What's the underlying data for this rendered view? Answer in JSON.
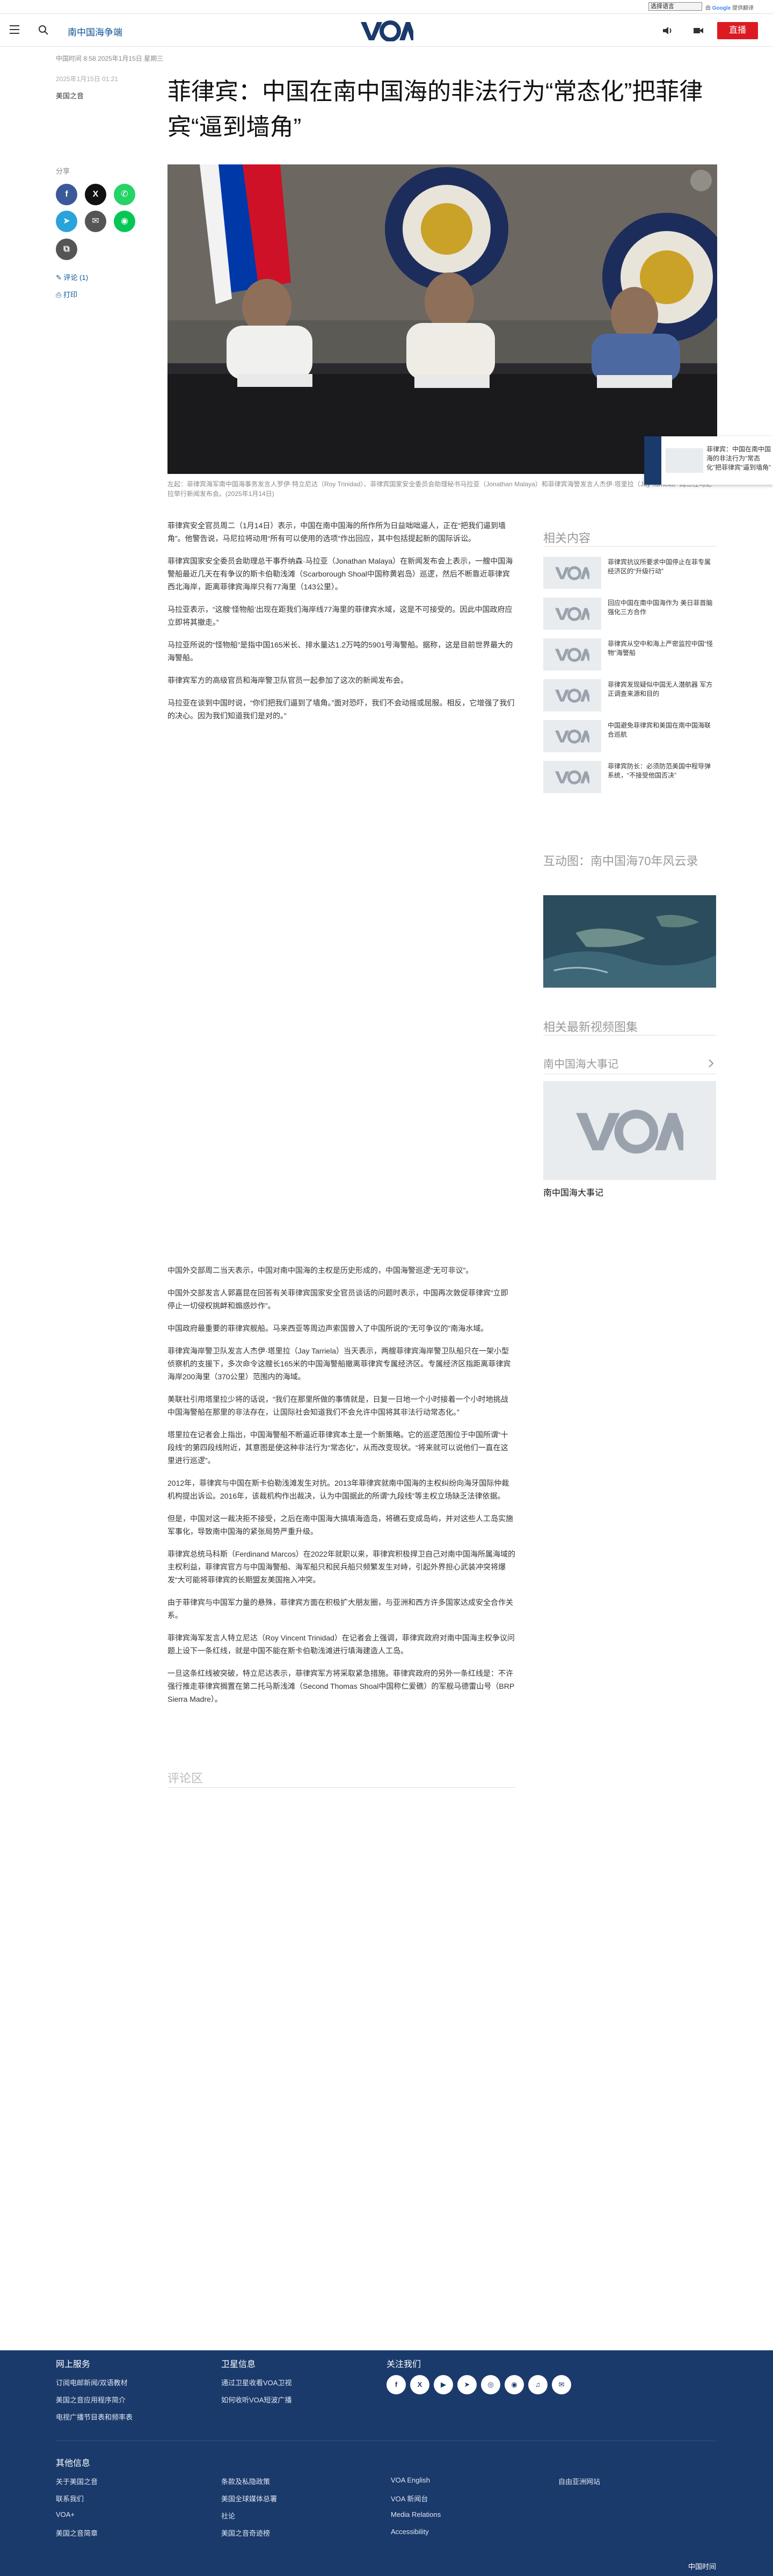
{
  "translate": {
    "select_value": "选择语言",
    "powered_prefix": "由",
    "powered_brand": "Google",
    "powered_suffix": "提供翻译"
  },
  "header": {
    "section": "南中国海争端",
    "live": "直播"
  },
  "article": {
    "meta_line": "中国时间 8:58 2025年1月15日 星期三",
    "date_line": "2025年1月15日 01:21",
    "category": "美国之音",
    "title": "菲律宾：中国在南中国海的非法行为“常态化”把菲律宾“逼到墙角”",
    "caption": "左起：菲律宾海军南中国海事务发言人罗伊·特立尼达（Roy Trinidad）、菲律宾国家安全委员会助理秘书马拉亚（Jonathan Malaya）和菲律宾海警发言人杰伊·塔里拉（Jay Tarriela）周二在马尼拉举行新闻发布会。(2025年1月14日)",
    "paragraphs_top": [
      "菲律宾安全官员周二（1月14日）表示，中国在南中国海的所作所为日益咄咄逼人，正在“把我们逼到墙角”。他警告说，马尼拉将动用“所有可以使用的选项”作出回应，其中包括提起新的国际诉讼。",
      "菲律宾国家安全委员会助理总干事乔纳森·马拉亚（Jonathan Malaya）在新闻发布会上表示，一艘中国海警船最近几天在有争议的斯卡伯勒浅滩（Scarborough Shoal中国称黄岩岛）巡逻，然后不断靠近菲律宾西北海岸，距离菲律宾海岸只有77海里（143公里）。",
      "马拉亚表示，“这艘‘怪物船’出现在距我们海岸线77海里的菲律宾水域，这是不可接受的。因此中国政府应立即将其撤走。”",
      "马拉亚所说的“怪物船”是指中国165米长、排水量达1.2万吨的5901号海警船。据称，这是目前世界最大的海警船。",
      "菲律宾军方的高级官员和海岸警卫队官员一起参加了这次的新闻发布会。",
      "马拉亚在谈到中国时说，“你们把我们逼到了墙角。”面对恐吓，我们不会动摇或屈服。相反，它增强了我们的决心。因为我们知道我们是对的。”"
    ],
    "paragraphs_bottom": [
      "中国外交部周二当天表示，中国对南中国海的主权是历史形成的，中国海警巡逻“无可非议”。",
      "中国外交部发言人郭嘉昆在回答有关菲律宾国家安全官员谈话的问题时表示，中国再次敦促菲律宾“立即停止一切侵权挑衅和煽惑炒作”。",
      "中国政府最重要的菲律宾舰船。马来西亚等周边声索国曾入了中国所说的“无可争议的”南海水域。",
      "菲律宾海岸警卫队发言人杰伊·塔里拉（Jay Tarriela）当天表示，两艘菲律宾海岸警卫队船只在一架小型侦察机的支援下，多次命令这艘长165米的中国海警船撤离菲律宾专属经济区。专属经济区指距离菲律宾海岸200海里（370公里）范围内的海域。",
      "美联社引用塔里拉少将的话说，“我们在那里所做的事情就是，日复一日地一个小时接着一个小时地挑战中国海警船在那里的非法存在，让国际社会知道我们不会允许中国将其非法行动常态化。”",
      "塔里拉在记者会上指出，中国海警船不断逼近菲律宾本土是一个新策略。它的巡逻范围位于中国所谓“十段线”的第四段线附近，其意图是使这种非法行为“常态化”，从而改变现状。“将来就可以说他们一直在这里进行巡逻”。",
      "2012年，菲律宾与中国在斯卡伯勒浅滩发生对抗。2013年菲律宾就南中国海的主权纠纷向海牙国际仲裁机构提出诉讼。2016年，该裁机构作出裁决，认为中国据此的所谓“九段线”等主权立场缺乏法律依据。",
      "但是，中国对这一裁决拒不接受，之后在南中国海大搞填海造岛，将礁石变成岛屿，并对这些人工岛实施军事化，导致南中国海的紧张局势严重升级。",
      "菲律宾总统马科斯（Ferdinand Marcos）在2022年就职以来，菲律宾积极捍卫自己对南中国海所属海域的主权利益，菲律宾官方与中国海警船、海军船只和民兵船只频繁发生对峙，引起外界担心武装冲突将爆发“大可能将菲律宾的长期盟友美国拖入冲突。",
      "由于菲律宾与中国军力量的悬殊，菲律宾方面在积极扩大朋友圈，与亚洲和西方许多国家达成安全合作关系。",
      "菲律宾海军发言人特立尼达（Roy Vincent Trinidad）在记者会上强调，菲律宾政府对南中国海主权争议问题上设下一条红线，就是中国不能在斯卡伯勒浅滩进行填海建造人工岛。",
      "一旦这条红线被突破，特立尼达表示，菲律宾军方将采取紧急措施。菲律宾政府的另外一条红线是：不许强行推走菲律宾搁置在第二托马斯浅滩（Second Thomas Shoal中国称仁爱礁）的军舰马德雷山号（BRP Sierra Madre）。"
    ],
    "comments_heading": "评论区"
  },
  "share": {
    "label": "分享",
    "comments_link": "评论 (1)",
    "print_link": "打印"
  },
  "sidebar": {
    "related_heading": "相关内容",
    "related_items": [
      "菲律宾抗议所要求中国停止在菲专属经济区的“升级行动”",
      "回应中国在南中国海作为 美日菲首脑强化三方合作",
      "菲律宾从空中和海上严密监控中国“怪物”海警船",
      "菲律宾发现疑似中国无人潜航器 军方正调查来源和目的",
      "中国避免菲律宾和美国在南中国海联合巡航",
      "菲律宾防长：必须防范美国中程导弹系统，“不接受他国否决”"
    ],
    "interactive_heading": "互动图：南中国海70年风云录",
    "video_heading": "相关最新视频图集",
    "timeline_heading": "南中国海大事记",
    "timeline_caption": "南中国海大事记"
  },
  "footer": {
    "col1_head": "网上服务",
    "col1_links": [
      "订阅电邮新闻/双语教材",
      "美国之音应用程序简介",
      "电视广播节目表和频率表"
    ],
    "col2_head": "卫星信息",
    "col2_links": [
      "通过卫星收看VOA卫视",
      "如何收听VOA短波广播"
    ],
    "col3_head": "关注我们",
    "social_icons": [
      "facebook-icon",
      "x-icon",
      "youtube-icon",
      "telegram-icon",
      "instagram-icon",
      "rss-icon",
      "podcast-icon",
      "email-icon"
    ],
    "other_head": "其他信息",
    "other_links": [
      [
        "关于美国之音",
        "条款及私隐政策",
        "VOA English",
        "自由亚洲网站"
      ],
      [
        "联系我们",
        "美国全球媒体总署",
        "VOA 新闻台",
        ""
      ],
      [
        "VOA+",
        "社论",
        "Media Relations",
        ""
      ],
      [
        "美国之音简章",
        "美国之音奇迹榜",
        "Accessibility",
        ""
      ]
    ],
    "brand": "中国时间"
  },
  "colors": {
    "brand_navy": "#1a3a6b",
    "live_red": "#dd1a22",
    "link_blue": "#0b5394"
  }
}
